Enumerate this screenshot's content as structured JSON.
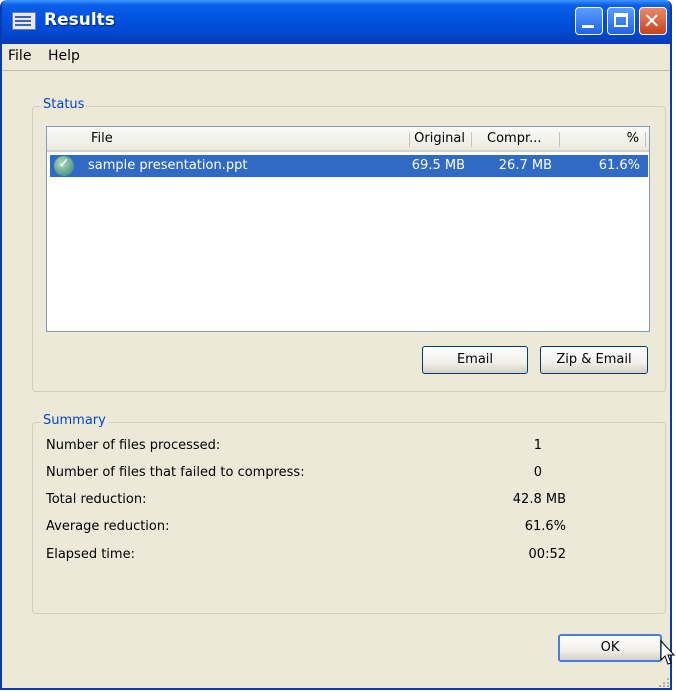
{
  "window": {
    "title": "Results"
  },
  "menu": {
    "items": [
      "File",
      "Help"
    ]
  },
  "status": {
    "group_label": "Status",
    "columns": [
      "File",
      "Original",
      "Compr...",
      "%"
    ],
    "rows": [
      {
        "file": "sample presentation.ppt",
        "original": "69.5 MB",
        "compressed": "26.7 MB",
        "percent": "61.6%",
        "status_icon": "checkmark-circle-icon"
      }
    ],
    "buttons": {
      "email": "Email",
      "zip_email": "Zip & Email"
    }
  },
  "summary": {
    "group_label": "Summary",
    "rows": [
      {
        "label": "Number of files processed:",
        "value": "1"
      },
      {
        "label": "Number of files that failed to compress:",
        "value": "0"
      },
      {
        "label": "Total reduction:",
        "value": "42.8 MB"
      },
      {
        "label": "Average reduction:",
        "value": "61.6%"
      },
      {
        "label": "Elapsed time:",
        "value": "00:52"
      }
    ]
  },
  "footer": {
    "ok_label": "OK"
  },
  "colors": {
    "titlebar": "#0254e0",
    "selection": "#316ac5",
    "group_label": "#0046d5",
    "face": "#ece9d8"
  }
}
